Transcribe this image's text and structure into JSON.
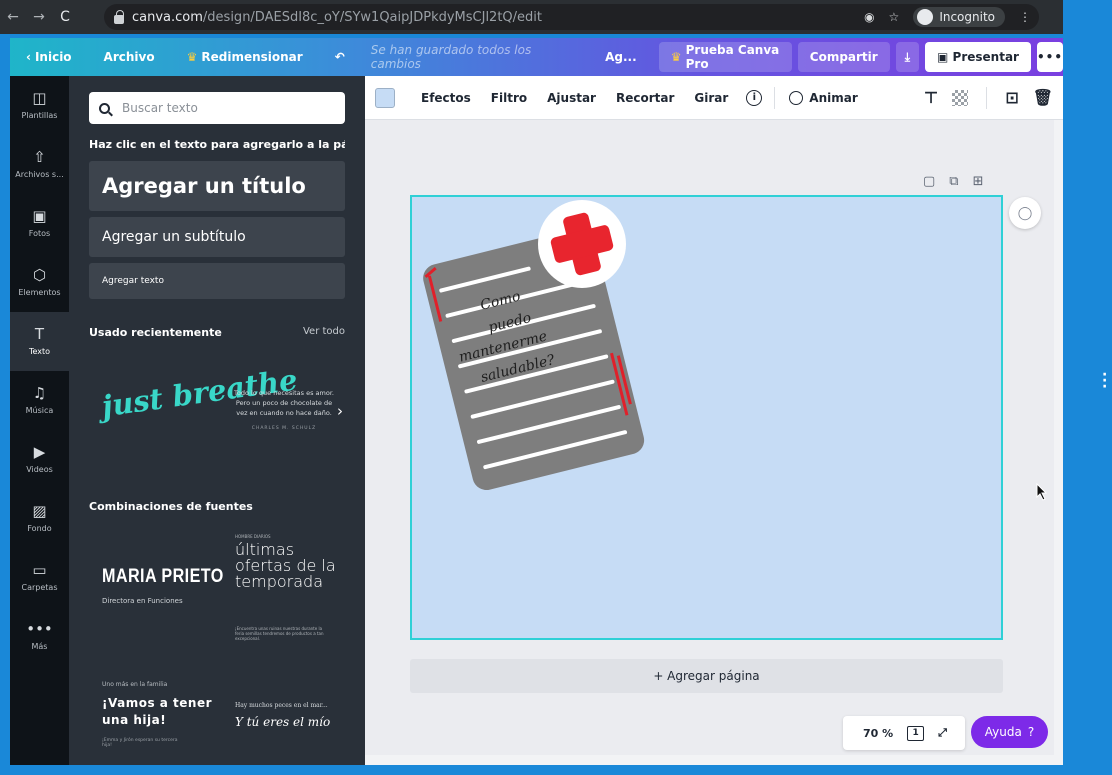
{
  "browser": {
    "url_host": "canva.com",
    "url_path": "/design/DAESdI8c_oY/SYw1QaipJDPkdyMsCJl2tQ/edit",
    "incognito_label": "Incognito"
  },
  "topbar": {
    "back_label": "Inicio",
    "file_label": "Archivo",
    "resize_label": "Redimensionar",
    "saved_status": "Se han guardado todos los cambios",
    "title_short": "Ag...",
    "try_pro_label": "Prueba Canva Pro",
    "share_label": "Compartir",
    "present_label": "Presentar"
  },
  "rail": {
    "items": [
      {
        "label": "Plantillas",
        "icon": "templates-icon",
        "glyph": "◫"
      },
      {
        "label": "Archivos s...",
        "icon": "uploads-icon",
        "glyph": "⇧"
      },
      {
        "label": "Fotos",
        "icon": "photos-icon",
        "glyph": "▣"
      },
      {
        "label": "Elementos",
        "icon": "elements-icon",
        "glyph": "⬡"
      },
      {
        "label": "Texto",
        "icon": "text-icon",
        "glyph": "T"
      },
      {
        "label": "Música",
        "icon": "music-icon",
        "glyph": "♫"
      },
      {
        "label": "Videos",
        "icon": "video-icon",
        "glyph": "▶"
      },
      {
        "label": "Fondo",
        "icon": "background-icon",
        "glyph": "▨"
      },
      {
        "label": "Carpetas",
        "icon": "folder-icon",
        "glyph": "▭"
      },
      {
        "label": "Más",
        "icon": "more-icon",
        "glyph": "•••"
      }
    ]
  },
  "panel": {
    "search_placeholder": "Buscar texto",
    "hint": "Haz clic en el texto para agregarlo a la pági...",
    "add_title": "Agregar un título",
    "add_subtitle": "Agregar un subtítulo",
    "add_text": "Agregar texto",
    "recent_heading": "Usado recientemente",
    "see_all": "Ver todo",
    "recent_1": "just breathe",
    "recent_2": "Todo lo que necesitas es amor. Pero un poco de chocolate de vez en cuando no hace daño.",
    "recent_2_author": "CHARLES M. SCHULZ",
    "combos_heading": "Combinaciones de fuentes",
    "combo_1_title": "MARIA PRIETO",
    "combo_1_sub": "Directora en Funciones",
    "combo_2_small": "HOMBRE DIARIOS",
    "combo_2_title": "últimas ofertas de la temporada",
    "combo_2_fine": "¡Encuentra unas ruinas nuestras durante la feria semillas tendremos de productos a tan excepcional.",
    "combo_3_small": "Uno más en la familia",
    "combo_3_title": "¡Vamos a tener una hija!",
    "combo_3_fine": "¡Emma y Jirón esperan su tercera hija!",
    "combo_4_small": "Hay muchos peces en el mar...",
    "combo_4_title": "Y tú eres el mío"
  },
  "toolbar": {
    "effects": "Efectos",
    "filter": "Filtro",
    "adjust": "Ajustar",
    "crop": "Recortar",
    "flip": "Girar",
    "animate": "Animar",
    "swatch_color": "#c6dcf5"
  },
  "canvas": {
    "background_color": "#c6dcf5",
    "note_lines": [
      "Como",
      "puedo",
      "mantenerme",
      "saludable?"
    ],
    "add_page": "+ Agregar página",
    "zoom": "70 %",
    "page_number": "1",
    "help_label": "Ayuda",
    "help_q": "?"
  },
  "colors": {
    "accent_purple": "#7d2ae8",
    "selection": "#2fd0d6",
    "rail_bg": "#0e1318",
    "panel_bg": "#293039"
  }
}
